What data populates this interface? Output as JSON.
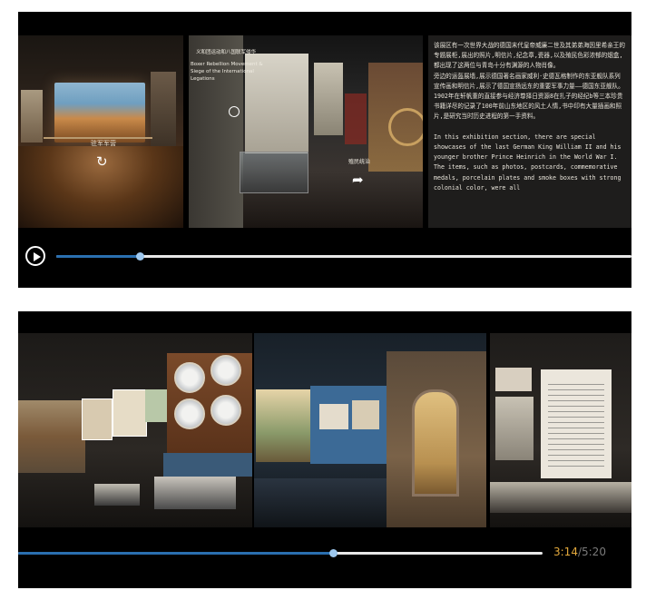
{
  "player1": {
    "progress": 0.145,
    "play_button": "play",
    "frame_left": {
      "label": "驻军军营"
    },
    "frame_middle": {
      "caption_title": "义和团运动和八国联军侵华",
      "caption": "Boxer Rebellion Movement & Siege of the International Legations",
      "label": "殖民统治"
    },
    "frame_text": {
      "chinese": "该展区有一次世界大战的德国末代皇帝威廉二世及其弟弟海因里希亲王的专题展柜,展出的照片,明信片,纪念章,瓷器,以及殖民色彩浓郁的烟盒,都出现了这两位与青岛十分有渊源的人物肖像。\n旁边的运盔展墙,展示德国著名画家威利·史德瓦格制作的东亚舰队系列宣传画和明信片,展示了德国宣扬远东的重要军事力量——德国东亚舰队。\n1902年在轩帆重的直接参与经济尊择日资源8在扎子的经纪b等三本珍贵书籍详尽的记录了100年前山东地区的风土人情,书中印有大量插画和照片,是研究当时历史进程的第一手资料。",
      "english": "In this exhibition section, there are special showcases of the last German King William II and his younger brother Prince Heinrich in the World War I. The items, such as photos, postcards, commemorative medals, porcelain plates and smoke boxes with strong colonial color, were all"
    }
  },
  "player2": {
    "progress": 0.6,
    "current_time": "3:14",
    "separator": "/",
    "duration": "5:20"
  }
}
